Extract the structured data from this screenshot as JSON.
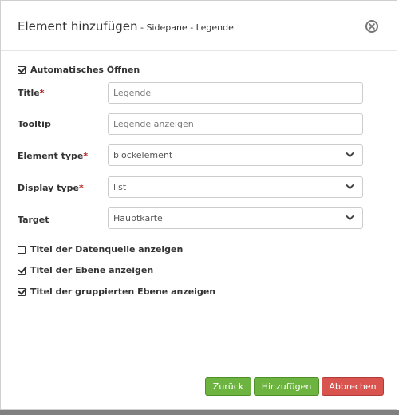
{
  "dialog": {
    "title": "Element hinzufügen",
    "subtitle": " - Sidepane - Legende",
    "close_icon": "close-circle-icon"
  },
  "auto_open": {
    "label": "Automatisches Öffnen",
    "checked": true
  },
  "fields": {
    "title": {
      "label": "Title",
      "required_mark": "*",
      "placeholder": "Legende"
    },
    "tooltip": {
      "label": "Tooltip",
      "placeholder": "Legende anzeigen"
    },
    "element_type": {
      "label": "Element type",
      "required_mark": "*",
      "value": "blockelement"
    },
    "display_type": {
      "label": "Display type",
      "required_mark": "*",
      "value": "list"
    },
    "target": {
      "label": "Target",
      "value": "Hauptkarte"
    }
  },
  "options": {
    "show_datasource": {
      "label": "Titel der Datenquelle anzeigen",
      "checked": false
    },
    "show_layer": {
      "label": "Titel der Ebene anzeigen",
      "checked": true
    },
    "show_grouped_layer": {
      "label": "Titel der gruppierten Ebene anzeigen",
      "checked": true
    }
  },
  "buttons": {
    "back": "Zurück",
    "add": "Hinzufügen",
    "cancel": "Abbrechen"
  },
  "colors": {
    "green": "#6db33f",
    "red": "#d9534f",
    "required": "#b22222"
  }
}
